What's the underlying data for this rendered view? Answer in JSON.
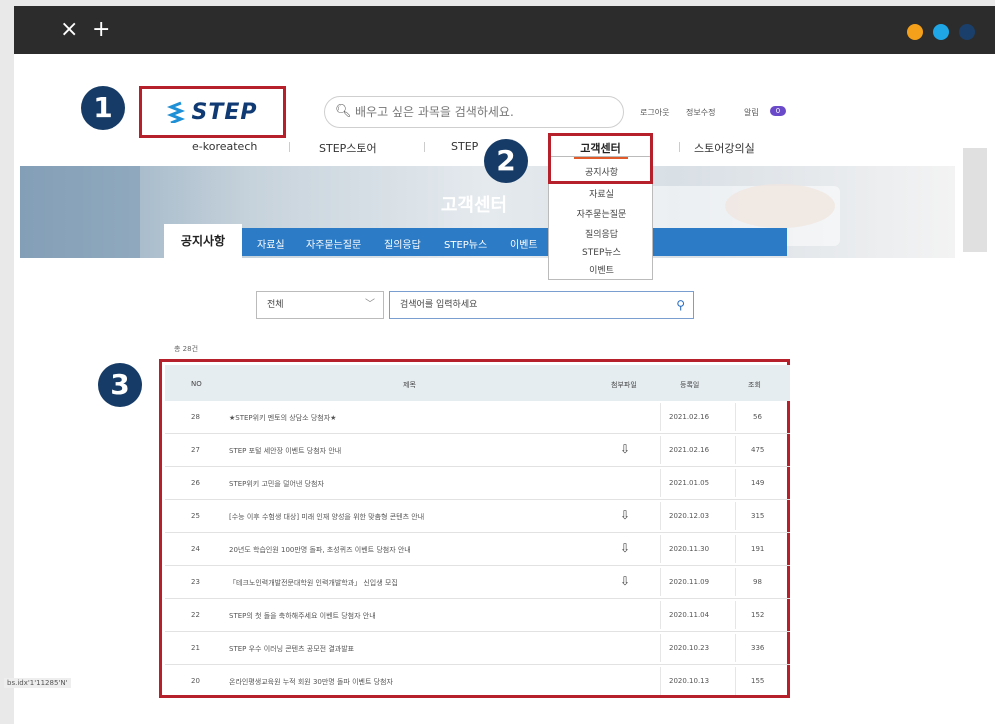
{
  "window": {
    "close": "×",
    "new_tab": "+",
    "dots": [
      "#f5a01a",
      "#1fa6e6",
      "#1b3f6b"
    ]
  },
  "header": {
    "logo": "STEP",
    "sublogo": "e-koreatech",
    "search_placeholder": "배우고 싶은 과목을 검색하세요.",
    "util": [
      "로그아웃",
      "정보수정",
      "알림"
    ],
    "util_badge": "0",
    "nav": [
      "STEP스토어",
      "STEP",
      "고객센터",
      "스토어강의실"
    ]
  },
  "badges": [
    "1",
    "2",
    "3"
  ],
  "dropdown": [
    "공지사항",
    "자료실",
    "자주묻는질문",
    "질의응답",
    "STEP뉴스",
    "이벤트"
  ],
  "banner": {
    "title": "고객센터"
  },
  "tabs": {
    "active": "공지사항",
    "items": [
      "자료실",
      "자주묻는질문",
      "질의응답",
      "STEP뉴스",
      "이벤트"
    ]
  },
  "filter": {
    "select": "전체",
    "input": "검색어를 입력하세요"
  },
  "list": {
    "count": "총 28건",
    "headers": [
      "NO",
      "제목",
      "첨부파일",
      "등록일",
      "조회"
    ],
    "rows": [
      {
        "no": "28",
        "title": "★STEP위키 멘토의 상담소 당첨자★",
        "attach": false,
        "date": "2021.02.16",
        "views": "56"
      },
      {
        "no": "27",
        "title": "STEP 포털 세안장 이벤트 당첨자 안내",
        "attach": true,
        "date": "2021.02.16",
        "views": "475"
      },
      {
        "no": "26",
        "title": "STEP위키 고민을 덜어낸 당첨자",
        "attach": false,
        "date": "2021.01.05",
        "views": "149"
      },
      {
        "no": "25",
        "title": "[수능 이후 수험생 대상] 미래 인재 양성을 위한 맞춤형 콘텐츠 안내",
        "attach": true,
        "date": "2020.12.03",
        "views": "315"
      },
      {
        "no": "24",
        "title": "20년도 학습인원 100만명 돌파, 초성퀴즈 이벤트 당첨자 안내",
        "attach": true,
        "date": "2020.11.30",
        "views": "191"
      },
      {
        "no": "23",
        "title": "「테크노인력개발전문대학원 인력개발학과」 신입생 모집",
        "attach": true,
        "date": "2020.11.09",
        "views": "98"
      },
      {
        "no": "22",
        "title": "STEP의 첫 돌을 축하해주세요 이벤트 당첨자 안내",
        "attach": false,
        "date": "2020.11.04",
        "views": "152"
      },
      {
        "no": "21",
        "title": "STEP 우수 이러닝 콘텐츠 공모전 결과발표",
        "attach": false,
        "date": "2020.10.23",
        "views": "336"
      },
      {
        "no": "20",
        "title": "온라인평생교육원 누적 회원 30만명 돌파 이벤트 당첨자",
        "attach": false,
        "date": "2020.10.13",
        "views": "155"
      }
    ]
  },
  "footer_note": "bs.idx'1'11285'N'"
}
